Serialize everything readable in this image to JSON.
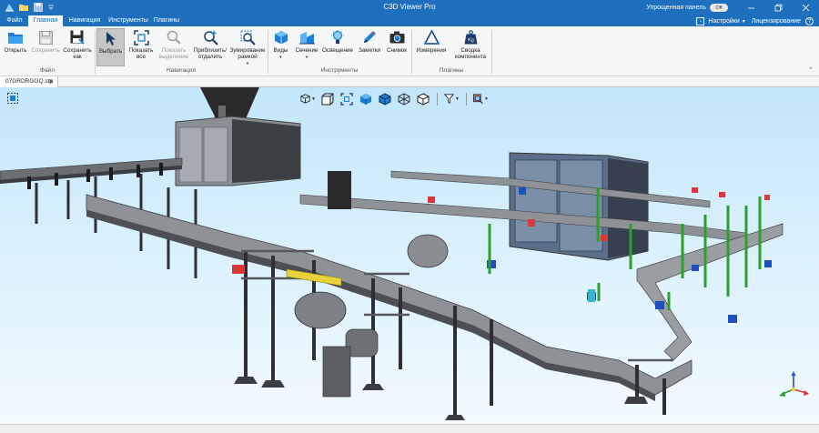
{
  "app": {
    "title": "C3D Viewer Pro",
    "simplified_panel_label": "Упрощенная панель",
    "toggle_state": "Off"
  },
  "tabs": [
    "Файл",
    "Главная",
    "Навигация",
    "Инструменты",
    "Плагины"
  ],
  "tab_right": {
    "settings": "Настройки",
    "licensing": "Лицензирование"
  },
  "ribbon": {
    "groups": {
      "file": "Файл",
      "navigation": "Навигация",
      "tools": "Инструменты",
      "plugins": "Плагины"
    },
    "buttons": {
      "open": "Открыть",
      "save": "Сохранить",
      "save_as": "Сохранить как",
      "select": "Выбрать",
      "show_all": "Показать все",
      "show_selection": "Показать выделение",
      "zoom": "Приблизить/ отдалить",
      "zoom_frame": "Зумирование рамкой",
      "views": "Виды",
      "section": "Сечение",
      "lighting": "Освещение",
      "notes": "Заметки",
      "snapshot": "Снимок",
      "measure": "Измерения",
      "component_summary": "Сводка компонента"
    }
  },
  "document": {
    "tab_name": "07GRDRGGQ.stp"
  },
  "colors": {
    "titlebar": "#1f6fbf",
    "ribbon_bg": "#f5f6f7",
    "viewport_top": "#c3e6fb",
    "viewport_bottom": "#f2fafe",
    "accent_blue": "#1f6fbf"
  }
}
